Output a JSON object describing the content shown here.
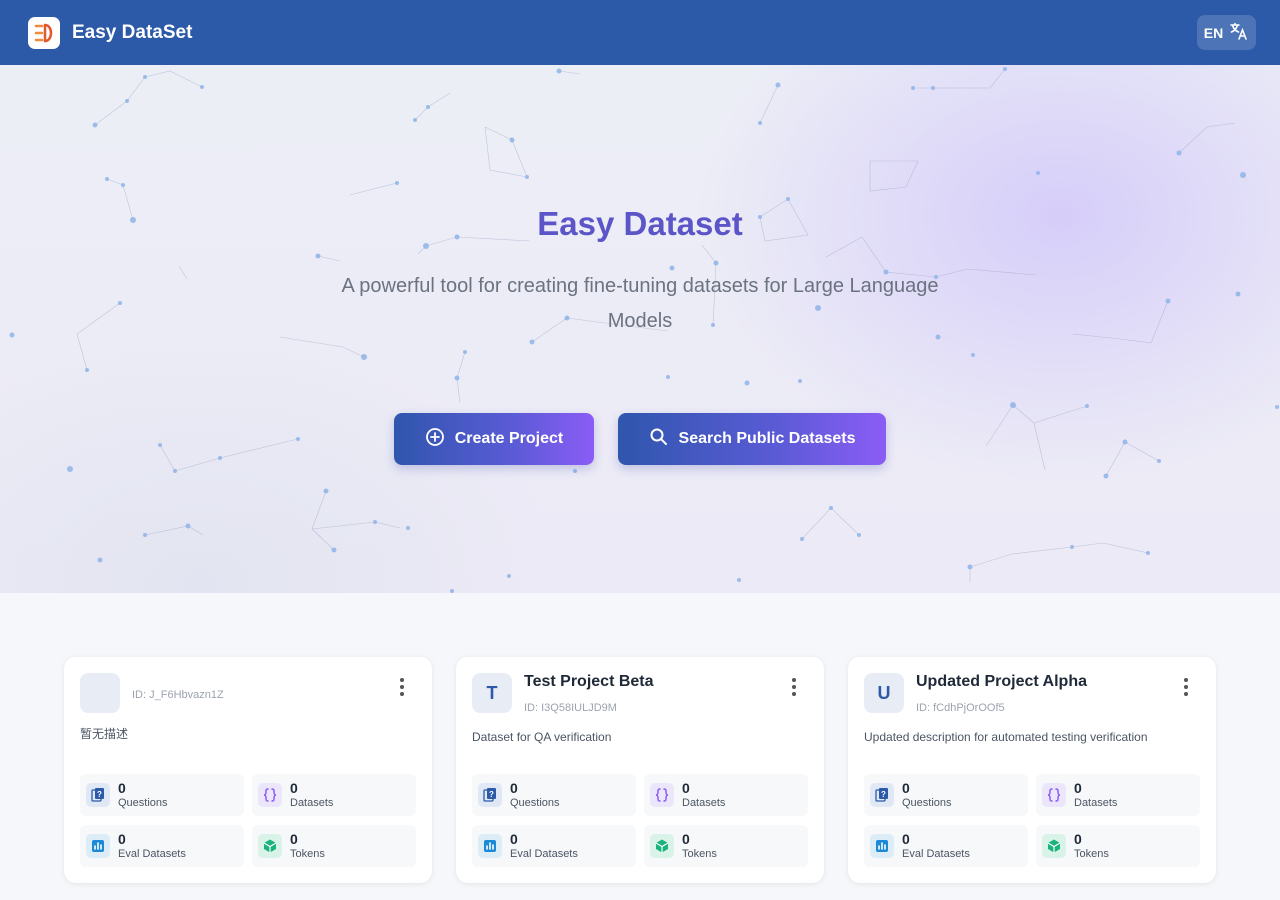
{
  "header": {
    "app_title": "Easy DataSet",
    "lang_label": "EN"
  },
  "hero": {
    "title": "Easy Dataset",
    "subtitle": "A powerful tool for creating fine-tuning datasets for Large Language Models",
    "create_label": "Create Project",
    "search_label": "Search Public Datasets"
  },
  "projects": [
    {
      "avatar": "",
      "name": "",
      "id": "ID: J_F6Hbvazn1Z",
      "description": "暂无描述",
      "questions": "0",
      "datasets": "0",
      "eval_datasets": "0",
      "tokens": "0"
    },
    {
      "avatar": "T",
      "name": "Test Project Beta",
      "id": "ID: I3Q58IULJD9M",
      "description": "Dataset for QA verification",
      "questions": "0",
      "datasets": "0",
      "eval_datasets": "0",
      "tokens": "0"
    },
    {
      "avatar": "U",
      "name": "Updated Project Alpha",
      "id": "ID: fCdhPjOrOOf5",
      "description": "Updated description for automated testing verification",
      "questions": "0",
      "datasets": "0",
      "eval_datasets": "0",
      "tokens": "0"
    }
  ],
  "stat_labels": {
    "questions": "Questions",
    "datasets": "Datasets",
    "eval_datasets": "Eval Datasets",
    "tokens": "Tokens"
  },
  "colors": {
    "header": "#2c5aa8",
    "accent": "#5b55c8",
    "button_start": "#2f56ad",
    "button_end": "#8b5cf6"
  },
  "icons": [
    "logo-icon",
    "translate-icon",
    "plus-circle-icon",
    "search-icon",
    "more-vert-icon",
    "questions-icon",
    "datasets-icon",
    "eval-chart-icon",
    "tokens-cube-icon"
  ]
}
